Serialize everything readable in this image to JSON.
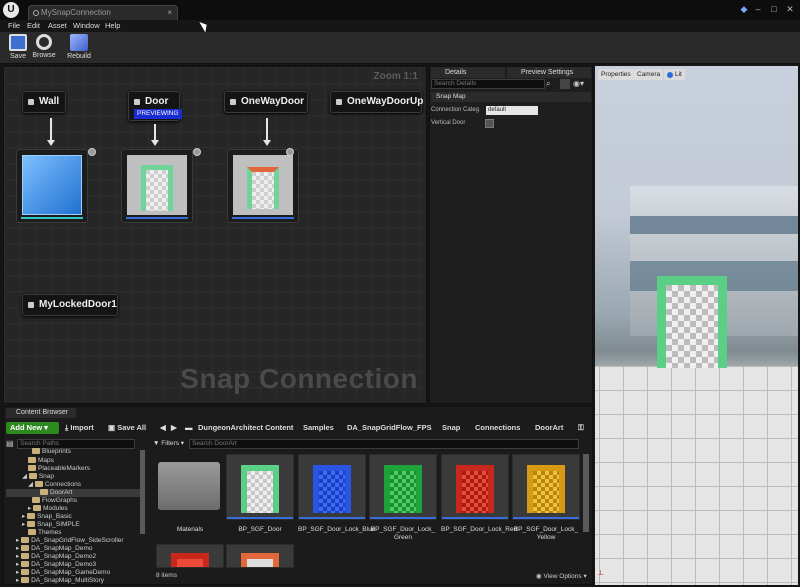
{
  "window": {
    "tab_title": "MySnapConnection"
  },
  "menu": [
    "File",
    "Edit",
    "Asset",
    "Window",
    "Help"
  ],
  "toolbar": {
    "save": "Save",
    "browse": "Browse",
    "rebuild": "Rebuild"
  },
  "graph": {
    "zoom": "Zoom 1:1",
    "watermark": "Snap Connection",
    "nodes": {
      "wall": "Wall",
      "door": "Door",
      "door_badge": "PREVIEWING",
      "oneway": "OneWayDoor",
      "onewayup": "OneWayDoorUp",
      "locked": "MyLockedDoor1"
    }
  },
  "details": {
    "tab_details": "Details",
    "tab_preview": "Preview Settings",
    "search_placeholder": "Search Details",
    "section": "Snap Map",
    "conn_label": "Connection Categ",
    "conn_value": "default",
    "vertical_label": "Vertical Door"
  },
  "viewport": {
    "properties": "Properties",
    "camera": "Camera",
    "lit": "Lit"
  },
  "content_browser": {
    "tab": "Content Browser",
    "add_new": "Add New",
    "import": "Import",
    "save_all": "Save All",
    "breadcrumbs": [
      "DungeonArchitect Content",
      "Samples",
      "DA_SnapGridFlow_FPS",
      "Snap",
      "Connections",
      "DoorArt"
    ],
    "search_paths": "Search Paths",
    "filters": "Filters",
    "search_door": "Search DoorArt",
    "tree": [
      "Blueprints",
      "Maps",
      "PlaceableMarkers",
      "Snap",
      "Connections",
      "DoorArt",
      "FlowGraphs",
      "Modules",
      "Snap_Basic",
      "Snap_SIMPLE",
      "Themes",
      "DA_SnapGridFlow_SideScroller",
      "DA_SnapMap_Demo",
      "DA_SnapMap_Demo2",
      "DA_SnapMap_Demo3",
      "DA_SnapMap_GameDemo",
      "DA_SnapMap_MultiStory"
    ],
    "assets": [
      "Materials",
      "BP_SGF_Door",
      "BP_SGF_Door_Lock_Blue",
      "BP_SGF_Door_Lock_Green",
      "BP_SGF_Door_Lock_Red",
      "BP_SGF_Door_Lock_Yellow"
    ],
    "items_count": "8 items",
    "view_options": "View Options"
  },
  "colors": {
    "accent": "#2e8a1f",
    "door_blue": "#3a6ddc",
    "door_red": "#d63b2b",
    "door_green": "#38b04a",
    "door_yellow": "#e0b22c"
  }
}
